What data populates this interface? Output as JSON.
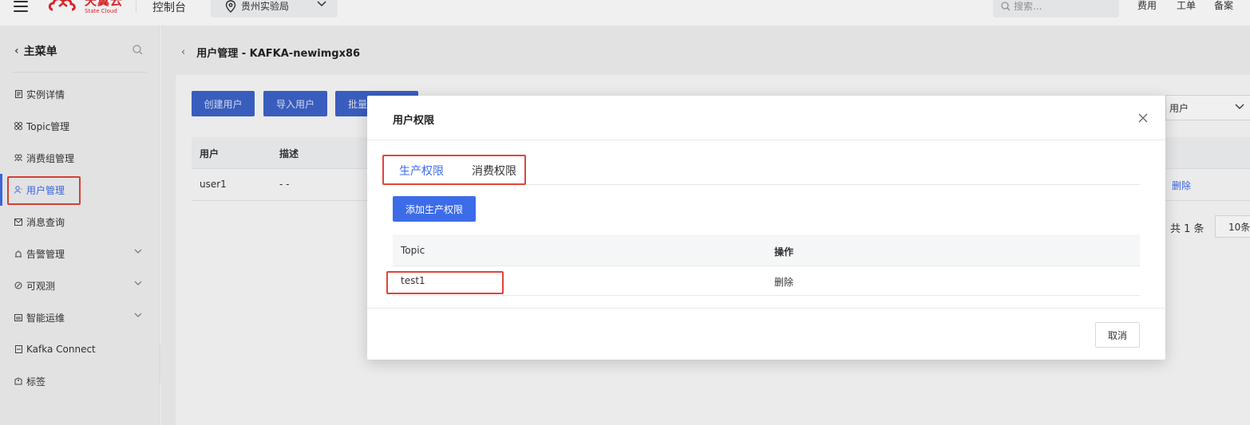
{
  "header": {
    "logo_cn": "天翼云",
    "logo_en": "State Cloud",
    "console_label": "控制台",
    "region_label": "贵州实验局",
    "search_placeholder": "搜索...",
    "links": [
      "费用",
      "工单",
      "备案"
    ]
  },
  "sidebar": {
    "title": "主菜单",
    "items": [
      {
        "label": "实例详情",
        "icon": "document-icon"
      },
      {
        "label": "Topic管理",
        "icon": "grid-icon"
      },
      {
        "label": "消费组管理",
        "icon": "group-icon"
      },
      {
        "label": "用户管理",
        "icon": "user-icon",
        "active": true
      },
      {
        "label": "消息查询",
        "icon": "mail-icon"
      },
      {
        "label": "告警管理",
        "icon": "alarm-icon",
        "expandable": true
      },
      {
        "label": "可观测",
        "icon": "observe-icon",
        "expandable": true
      },
      {
        "label": "智能运维",
        "icon": "ops-icon",
        "expandable": true
      },
      {
        "label": "Kafka Connect",
        "icon": "connect-icon"
      },
      {
        "label": "标签",
        "icon": "tag-icon"
      }
    ]
  },
  "main": {
    "breadcrumb": "用户管理 - KAFKA-newimgx86",
    "buttons": [
      "创建用户",
      "导入用户",
      "批量"
    ],
    "user_select": "用户",
    "table": {
      "headers": [
        "用户",
        "描述"
      ],
      "rows": [
        {
          "user": "user1",
          "desc": "- -",
          "action": "删除"
        }
      ]
    },
    "pager": {
      "total": "共 1 条",
      "size": "10条"
    }
  },
  "dialog": {
    "title": "用户权限",
    "tabs": [
      "生产权限",
      "消费权限"
    ],
    "active_tab": 0,
    "add_button": "添加生产权限",
    "table": {
      "headers": [
        "Topic",
        "操作"
      ],
      "rows": [
        {
          "topic": "test1",
          "action": "删除"
        }
      ]
    },
    "cancel_button": "取消"
  },
  "colors": {
    "accent": "#3d6ce8",
    "highlight_box": "#e0443a",
    "brand": "#e0292e"
  }
}
